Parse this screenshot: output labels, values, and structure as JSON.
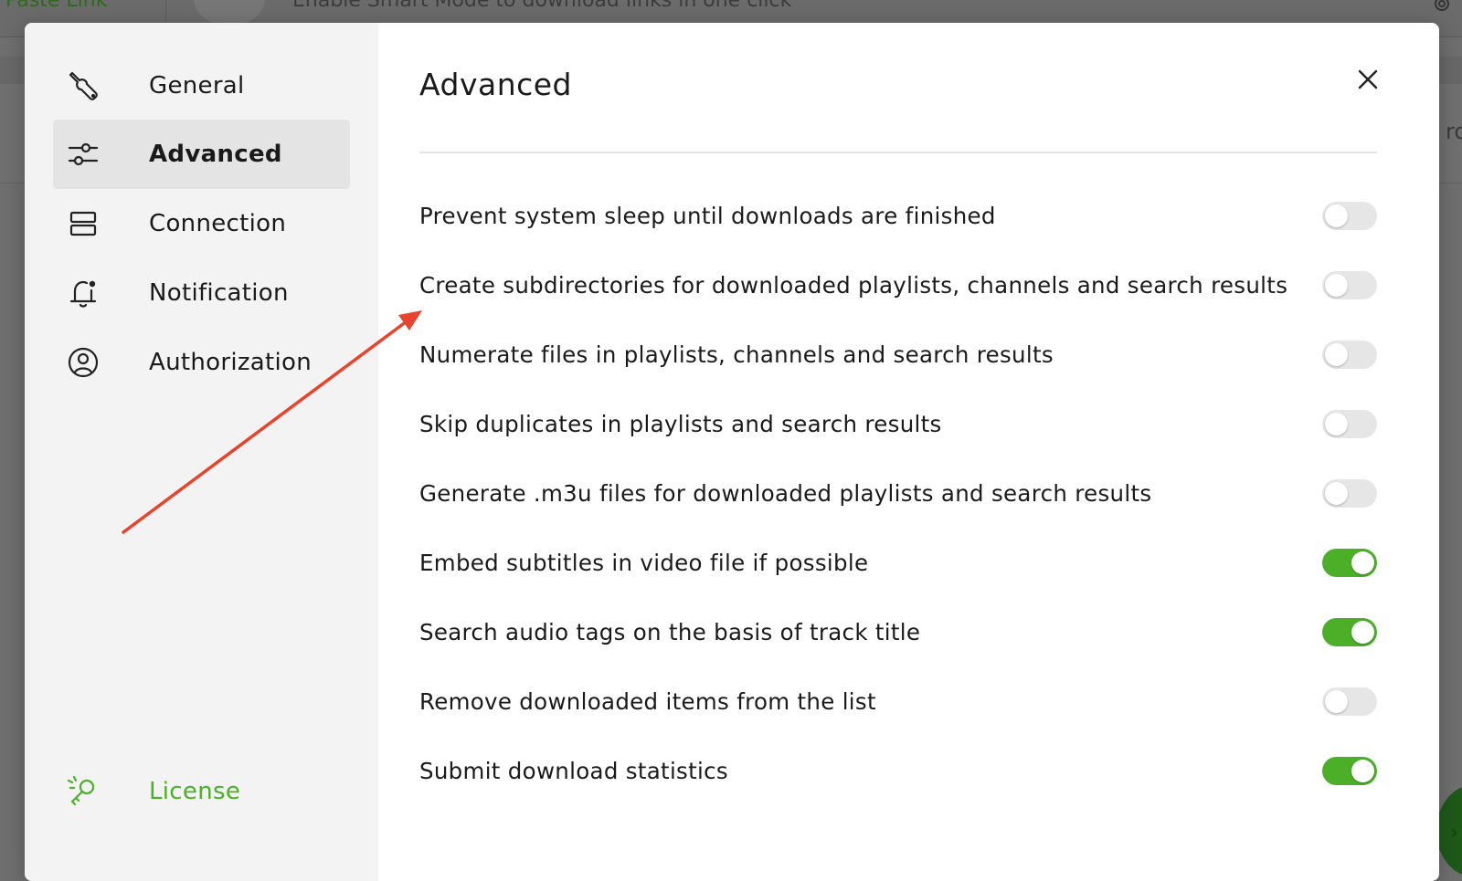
{
  "background_app": {
    "paste_link_label": "Paste Link",
    "smart_mode_text": "Enable Smart Mode to download links in one click",
    "edge_text": "ro"
  },
  "sidebar": {
    "items": [
      {
        "label": "General",
        "icon": "wrench-icon",
        "active": false
      },
      {
        "label": "Advanced",
        "icon": "sliders-icon",
        "active": true
      },
      {
        "label": "Connection",
        "icon": "server-icon",
        "active": false
      },
      {
        "label": "Notification",
        "icon": "bell-icon",
        "active": false
      },
      {
        "label": "Authorization",
        "icon": "user-circle-icon",
        "active": false
      }
    ],
    "license": {
      "label": "License",
      "icon": "key-icon",
      "color": "#4caf28"
    }
  },
  "main": {
    "title": "Advanced",
    "close_icon": "close-icon",
    "settings": [
      {
        "label": "Prevent system sleep until downloads are finished",
        "enabled": false
      },
      {
        "label": "Create subdirectories for downloaded playlists, channels and search results",
        "enabled": false
      },
      {
        "label": "Numerate files in playlists, channels and search results",
        "enabled": false
      },
      {
        "label": "Skip duplicates in playlists and search results",
        "enabled": false
      },
      {
        "label": "Generate .m3u files for downloaded playlists and search results",
        "enabled": false
      },
      {
        "label": "Embed subtitles in video file if possible",
        "enabled": true
      },
      {
        "label": "Search audio tags on the basis of track title",
        "enabled": true
      },
      {
        "label": "Remove downloaded items from the list",
        "enabled": false
      },
      {
        "label": "Submit download statistics",
        "enabled": true
      }
    ]
  },
  "colors": {
    "accent": "#4caf28",
    "toggle_off": "#e6e6e6",
    "annotation_arrow": "#e8432c"
  }
}
